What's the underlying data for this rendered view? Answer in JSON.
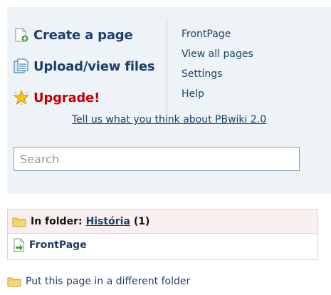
{
  "actions": {
    "create_page": "Create a page",
    "upload_files": "Upload/view files",
    "upgrade": "Upgrade!"
  },
  "links": {
    "front_page": "FrontPage",
    "view_all_pages": "View all pages",
    "settings": "Settings",
    "help": "Help"
  },
  "feedback_link": "Tell us what you think about PBwiki 2.0",
  "search": {
    "placeholder": "Search"
  },
  "folder": {
    "prefix": "In folder:",
    "name": "História",
    "count": "(1)",
    "page": "FrontPage"
  },
  "move_folder_link": "Put this page in a different folder",
  "colors": {
    "panel_background": "#eef3f8",
    "link_blue": "#1b3f6a",
    "upgrade_red": "#c60000",
    "folder_header_background": "#f9efef"
  },
  "icons": {
    "create_page": "new-page-icon",
    "upload_files": "files-icon",
    "upgrade": "star-icon",
    "folder": "folder-icon",
    "page": "page-arrow-icon"
  }
}
